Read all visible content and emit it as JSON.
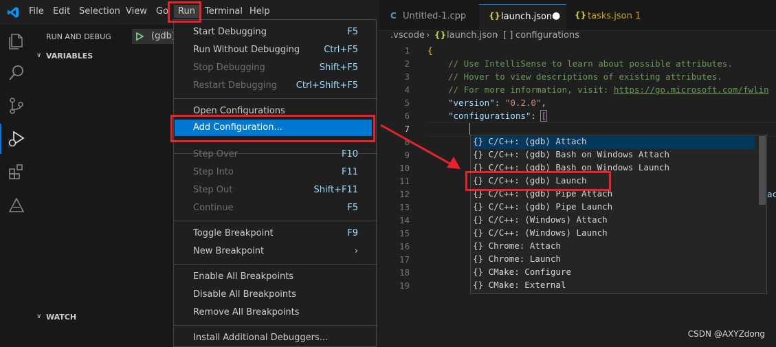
{
  "menubar": {
    "items": [
      "File",
      "Edit",
      "Selection",
      "View",
      "Go",
      "Run",
      "Terminal",
      "Help"
    ]
  },
  "sidebar": {
    "title": "RUN AND DEBUG",
    "config_selector": "(gdb)",
    "variables": "VARIABLES",
    "watch": "WATCH"
  },
  "run_menu": {
    "items": [
      {
        "label": "Start Debugging",
        "key": "F5",
        "disabled": false
      },
      {
        "label": "Run Without Debugging",
        "key": "Ctrl+F5",
        "disabled": false
      },
      {
        "label": "Stop Debugging",
        "key": "Shift+F5",
        "disabled": true
      },
      {
        "label": "Restart Debugging",
        "key": "Ctrl+Shift+F5",
        "disabled": true
      },
      {
        "label": "Open Configurations",
        "key": "",
        "disabled": false
      },
      {
        "label": "Add Configuration...",
        "key": "",
        "disabled": false
      },
      {
        "label": "Step Over",
        "key": "F10",
        "disabled": true
      },
      {
        "label": "Step Into",
        "key": "F11",
        "disabled": true
      },
      {
        "label": "Step Out",
        "key": "Shift+F11",
        "disabled": true
      },
      {
        "label": "Continue",
        "key": "F5",
        "disabled": true
      },
      {
        "label": "Toggle Breakpoint",
        "key": "F9",
        "disabled": false
      },
      {
        "label": "New Breakpoint",
        "key": "",
        "disabled": false
      },
      {
        "label": "Enable All Breakpoints",
        "key": "",
        "disabled": false
      },
      {
        "label": "Disable All Breakpoints",
        "key": "",
        "disabled": false
      },
      {
        "label": "Remove All Breakpoints",
        "key": "",
        "disabled": false
      },
      {
        "label": "Install Additional Debuggers...",
        "key": "",
        "disabled": false
      }
    ]
  },
  "tabs": [
    {
      "label": "Untitled-1.cpp",
      "icon": "C"
    },
    {
      "label": "launch.json",
      "icon": "{}"
    },
    {
      "label": "tasks.json 1",
      "icon": "{}"
    }
  ],
  "breadcrumb": {
    "folder": ".vscode",
    "file": "launch.json",
    "node": "configurations",
    "node_icon": "[ ]"
  },
  "editor": {
    "line_numbers": [
      "1",
      "2",
      "3",
      "4",
      "5",
      "6",
      "7",
      "8",
      "9",
      "10",
      "11",
      "12",
      "13",
      "14",
      "15",
      "16",
      "17",
      "18",
      "19"
    ],
    "comment1": "// Use IntelliSense to learn about possible attributes.",
    "comment2": "// Hover to view descriptions of existing attributes.",
    "comment3_prefix": "// For more information, visit: ",
    "comment3_link": "https://go.microsoft.com/fwlin",
    "version_key": "\"version\"",
    "version_val": "\"0.2.0\"",
    "configs_key": "\"configurations\"",
    "open_brace": "{",
    "open_bracket": "["
  },
  "suggestions": [
    "C/C++: (gdb) Attach",
    "C/C++: (gdb) Bash on Windows Attach",
    "C/C++: (gdb) Bash on Windows Launch",
    "C/C++: (gdb) Launch",
    "C/C++: (gdb) Pipe Attach",
    "C/C++: (gdb) Pipe Launch",
    "C/C++: (Windows) Attach",
    "C/C++: (Windows) Launch",
    "Chrome: Attach",
    "Chrome: Launch",
    "CMake: Configure",
    "CMake: External"
  ],
  "watermark": "CSDN @AXYZdong",
  "colors": {
    "accent": "#0078d4",
    "annotation": "#e8232c"
  }
}
